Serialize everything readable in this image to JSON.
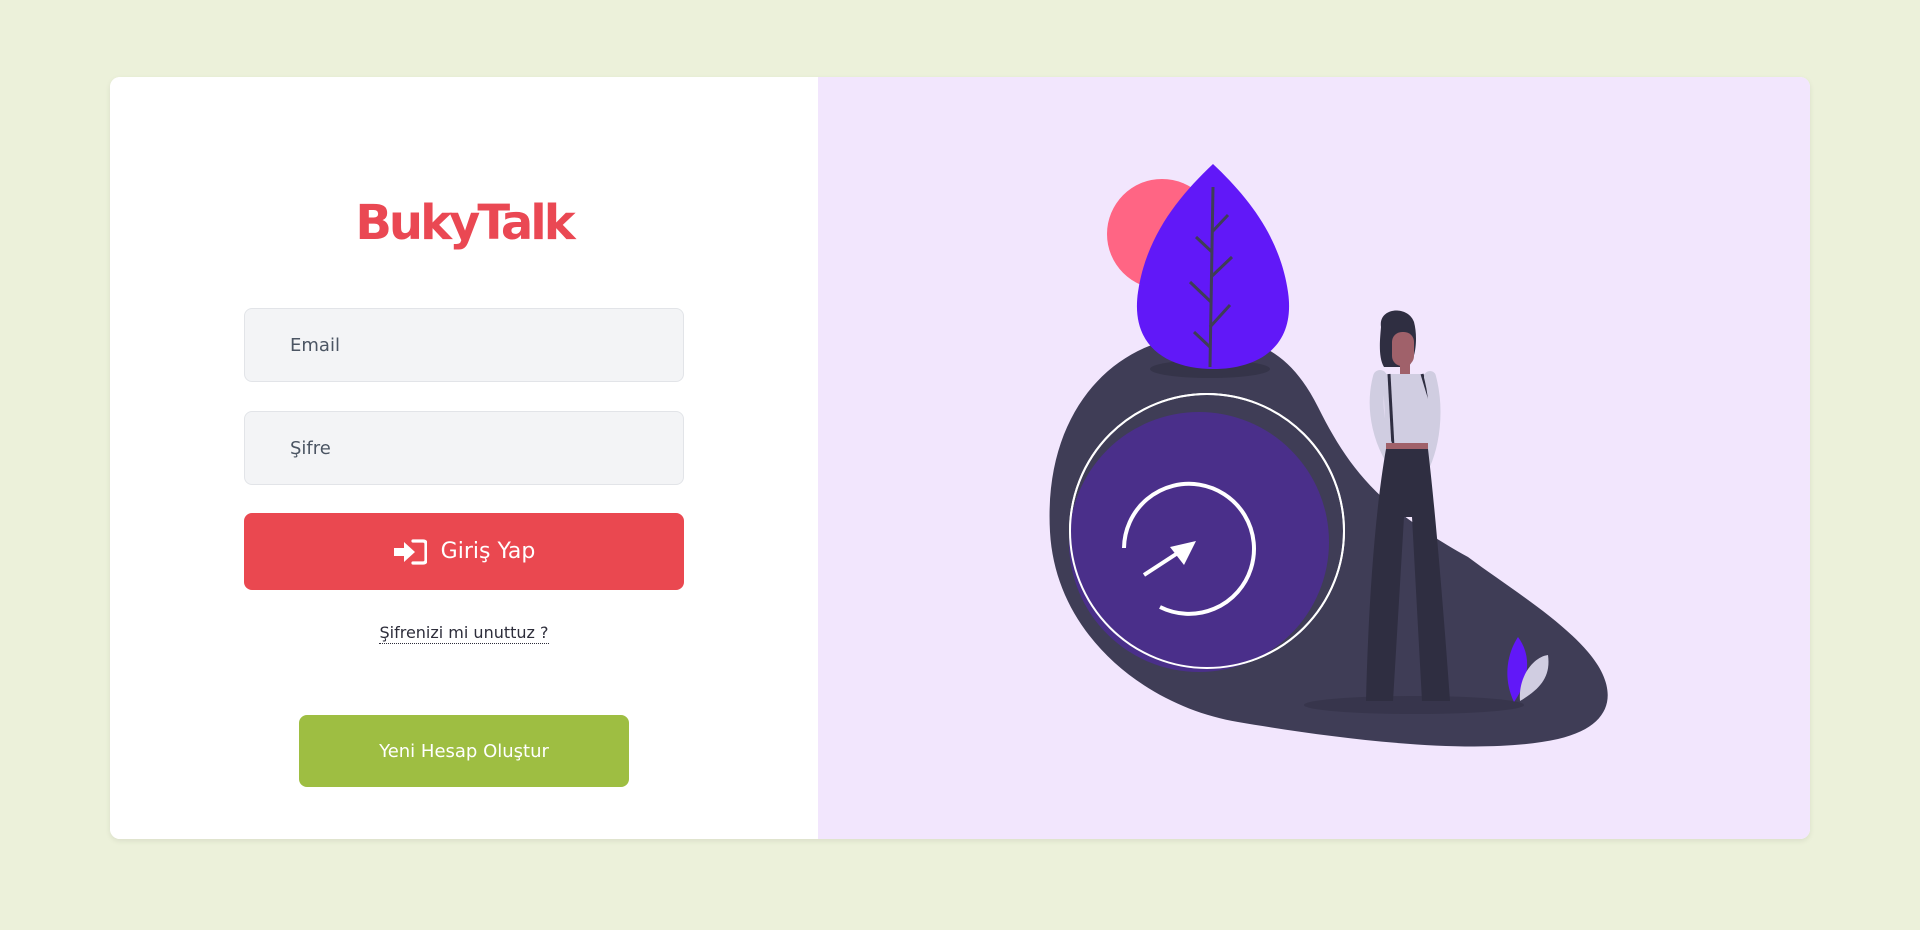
{
  "brand": {
    "name": "BukyTalk",
    "color": "#ea4853"
  },
  "login_form": {
    "email_placeholder": "Email",
    "password_placeholder": "Şifre",
    "login_button_label": "Giriş Yap",
    "login_button_icon": "sign-in-icon",
    "forgot_password_label": "Şifrenizi mi unuttuz ?",
    "create_account_label": "Yeni Hesap Oluştur"
  },
  "colors": {
    "page_background": "#ecf1da",
    "card_background": "#ffffff",
    "illustration_background": "#f2e6fd",
    "login_button": "#ea4850",
    "create_button": "#9ebe42",
    "accent_purple": "#6118f8",
    "accent_pink": "#ff6584",
    "dark_blob": "#3f3d56"
  },
  "illustration": {
    "name": "woman-with-clock-illustration"
  }
}
